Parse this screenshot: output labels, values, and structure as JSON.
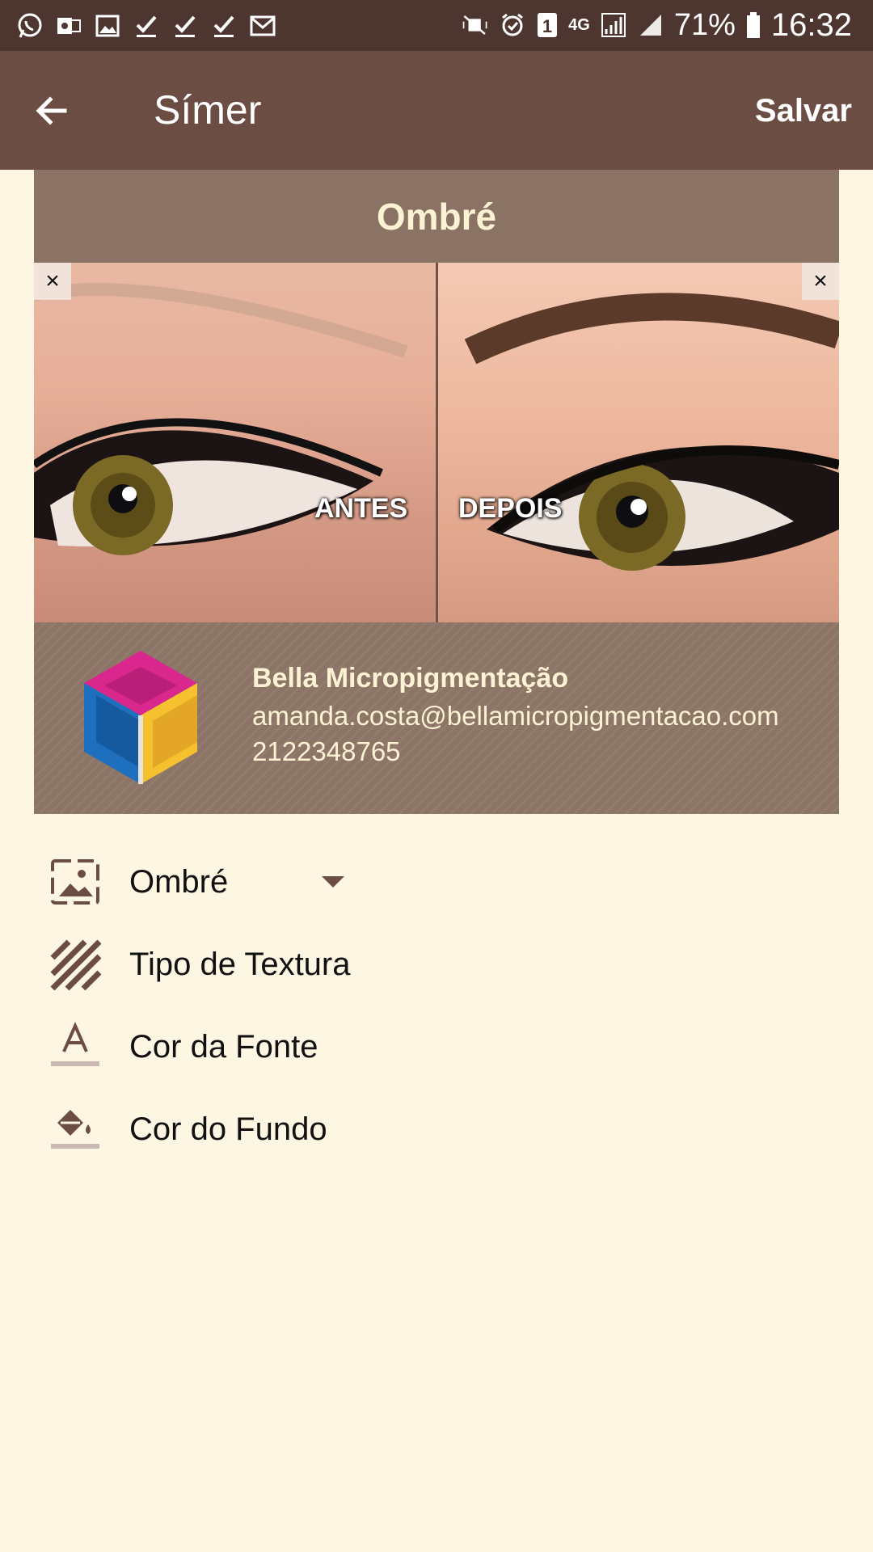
{
  "status_bar": {
    "sim_badge": "1",
    "network_type": "4G",
    "battery_percent": "71%",
    "time": "16:32",
    "left_icons": [
      "whatsapp-icon",
      "outlook-icon",
      "gallery-icon",
      "check-icon",
      "check-icon",
      "check-icon",
      "gmail-icon"
    ],
    "right_icons": [
      "mute-icon",
      "alarm-icon",
      "sim-icon",
      "network-icon",
      "signal-icon",
      "signal-icon",
      "battery-icon"
    ]
  },
  "app_bar": {
    "title": "Símer",
    "save_label": "Salvar",
    "back_icon": "arrow-left-icon"
  },
  "card": {
    "title": "Ombré",
    "before_label": "ANTES",
    "after_label": "DEPOIS",
    "close_glyph": "×",
    "business_name": "Bella Micropigmentação",
    "email": "amanda.costa@bellamicropigmentacao.com",
    "phone": "2122348765"
  },
  "options": {
    "style_label": "Ombré",
    "texture_label": "Tipo de Textura",
    "font_color_label": "Cor da Fonte",
    "background_color_label": "Cor do Fundo"
  },
  "colors": {
    "status_bar": "#4E3630",
    "app_bar": "#6B4D43",
    "background": "#FDF6E3",
    "card_title_bar": "#8A7264",
    "card_text": "#FDF3D4",
    "icon": "#6B4D43"
  }
}
